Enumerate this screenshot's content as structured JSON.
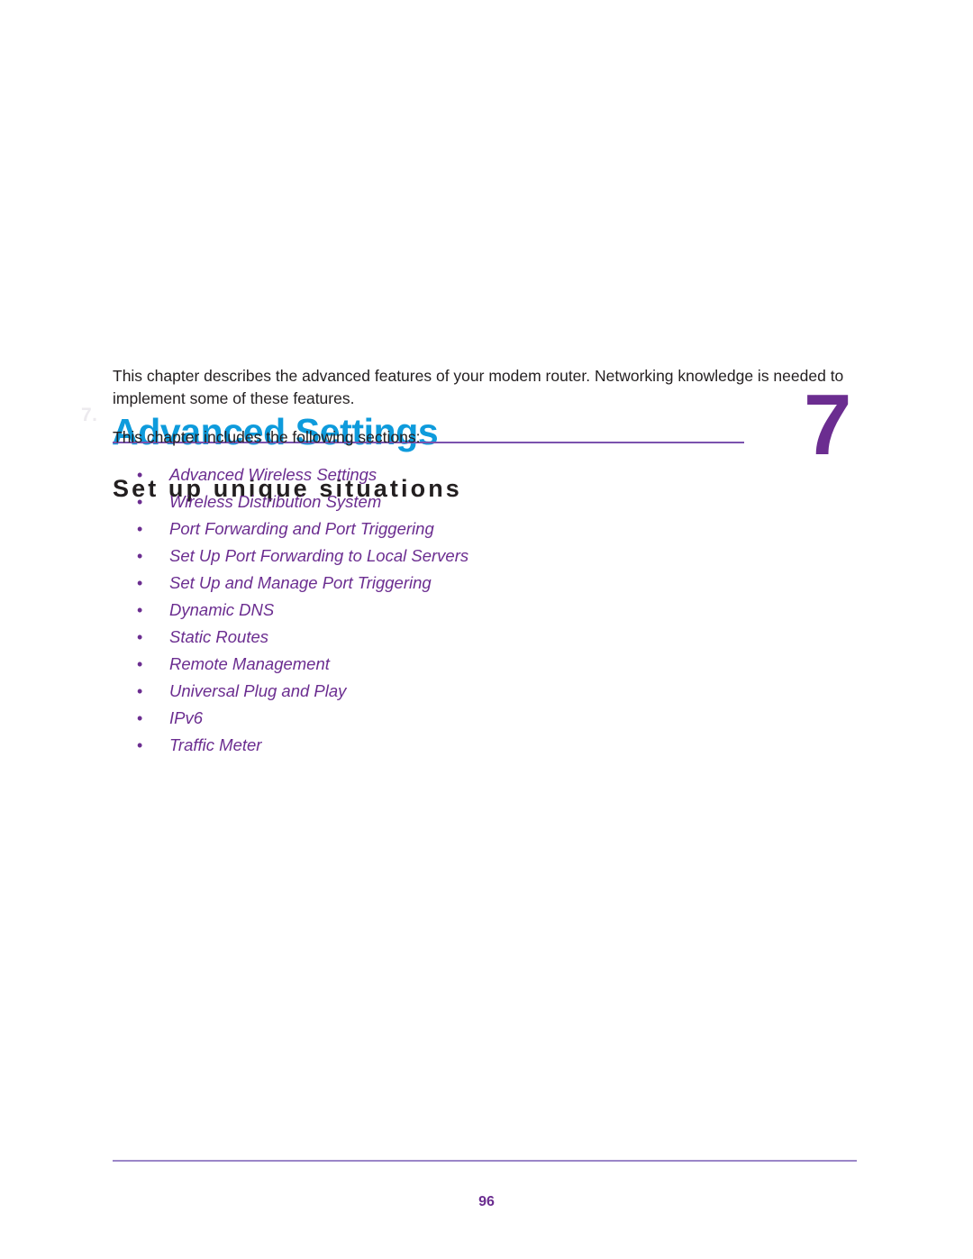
{
  "document": {
    "chapter": {
      "watermark": "7.",
      "title": "Advanced Settings",
      "subtitle": "Set up unique situations",
      "number": "7"
    },
    "body": {
      "paragraph_1": "This chapter describes the advanced features of your modem router. Networking knowledge is needed to implement some of these features.",
      "paragraph_2": "This chapter includes the following sections:"
    },
    "sections": [
      {
        "bullet": "•",
        "label": "Advanced Wireless Settings"
      },
      {
        "bullet": "•",
        "label": "Wireless Distribution System"
      },
      {
        "bullet": "•",
        "label": "Port Forwarding and Port Triggering"
      },
      {
        "bullet": "•",
        "label": "Set Up Port Forwarding to Local Servers"
      },
      {
        "bullet": "•",
        "label": "Set Up and Manage Port Triggering"
      },
      {
        "bullet": "•",
        "label": "Dynamic DNS"
      },
      {
        "bullet": "•",
        "label": "Static Routes"
      },
      {
        "bullet": "•",
        "label": "Remote Management"
      },
      {
        "bullet": "•",
        "label": "Universal Plug and Play"
      },
      {
        "bullet": "•",
        "label": "IPv6"
      },
      {
        "bullet": "•",
        "label": "Traffic Meter"
      }
    ],
    "footer": {
      "page_number": "96"
    },
    "colors": {
      "title_blue": "#0e9bdc",
      "accent_purple": "#6b2d90",
      "rule_purple": "#7b52ae",
      "footer_rule_purple": "#9b86c8",
      "body_text": "#231f20",
      "watermark_gray": "#eceaee"
    }
  }
}
